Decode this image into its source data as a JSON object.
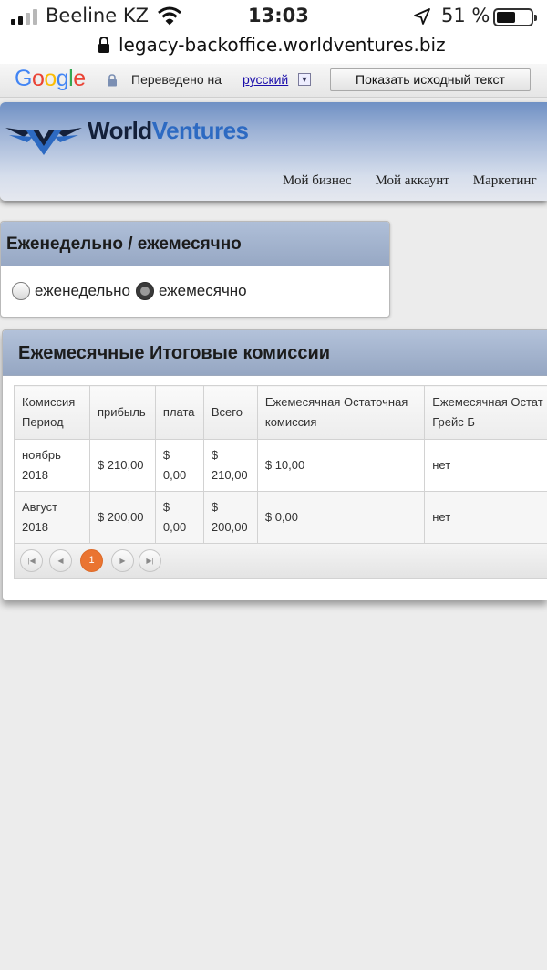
{
  "status_bar": {
    "carrier": "Beeline KZ",
    "time": "13:03",
    "battery_percent": "51 %"
  },
  "browser": {
    "url": "legacy-backoffice.worldventures.biz"
  },
  "translate_bar": {
    "logo": "Google",
    "translated_to": "Переведено на",
    "language": "русский",
    "show_original_button": "Показать исходный текст"
  },
  "header": {
    "brand_part1": "World",
    "brand_part2": "Ventures",
    "nav": [
      {
        "label": "Мой бизнес"
      },
      {
        "label": "Мой аккаунт"
      },
      {
        "label": "Маркетинг"
      }
    ]
  },
  "period_panel": {
    "title": "Еженедельно / ежемесячно",
    "options": [
      {
        "label": "еженедельно",
        "checked": false
      },
      {
        "label": "ежемесячно",
        "checked": true
      }
    ]
  },
  "commissions": {
    "title": "Ежемесячные Итоговые комиссии",
    "columns": [
      "Комиссия Период",
      "прибыль",
      "плата",
      "Всего",
      "Ежемесячная Остаточная комиссия",
      "Ежемесячная Остат Грейс Б"
    ],
    "rows": [
      [
        "ноябрь 2018",
        "$ 210,00",
        "$ 0,00",
        "$ 210,00",
        "$ 10,00",
        "нет"
      ],
      [
        "Август 2018",
        "$ 200,00",
        "$ 0,00",
        "$ 200,00",
        "$ 0,00",
        "нет"
      ]
    ],
    "pager": {
      "current_page": "1"
    }
  },
  "colors": {
    "accent_orange": "#ea7431",
    "brand_blue": "#2d6ac2",
    "brand_navy": "#14203a"
  }
}
